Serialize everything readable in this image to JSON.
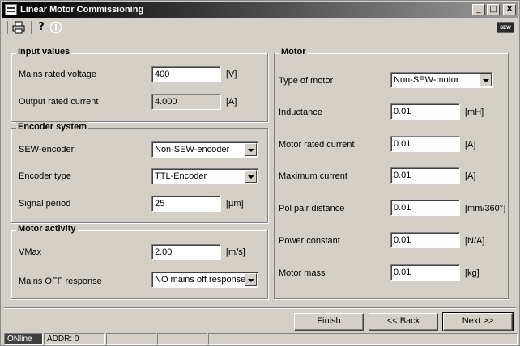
{
  "window": {
    "title": "Linear Motor Commissioning",
    "minimize": "_",
    "maximize": "□",
    "close": "X"
  },
  "toolbar": {
    "print_icon": "printer-icon",
    "help_icon": "question-icon",
    "info_icon": "info-icon",
    "logo_text": "SEW"
  },
  "input_values": {
    "title": "Input values",
    "mains_voltage_label": "Mains rated voltage",
    "mains_voltage_value": "400",
    "mains_voltage_unit": "[V]",
    "output_current_label": "Output rated current",
    "output_current_value": "4.000",
    "output_current_unit": "[A]"
  },
  "encoder_system": {
    "title": "Encoder system",
    "sew_encoder_label": "SEW-encoder",
    "sew_encoder_value": "Non-SEW-encoder",
    "encoder_type_label": "Encoder type",
    "encoder_type_value": "TTL-Encoder",
    "signal_period_label": "Signal period",
    "signal_period_value": "25",
    "signal_period_unit": "[µm]"
  },
  "motor_activity": {
    "title": "Motor activity",
    "vmax_label": "VMax",
    "vmax_value": "2.00",
    "vmax_unit": "[m/s]",
    "mains_off_label": "Mains OFF response",
    "mains_off_value": "NO mains off response"
  },
  "motor": {
    "title": "Motor",
    "type_label": "Type of motor",
    "type_value": "Non-SEW-motor",
    "inductance_label": "Inductance",
    "inductance_value": "0.01",
    "inductance_unit": "[mH]",
    "rated_current_label": "Motor rated current",
    "rated_current_value": "0.01",
    "rated_current_unit": "[A]",
    "max_current_label": "Maximum current",
    "max_current_value": "0.01",
    "max_current_unit": "[A]",
    "pol_pair_label": "Pol pair distance",
    "pol_pair_value": "0.01",
    "pol_pair_unit": "[mm/360°]",
    "power_const_label": "Power constant",
    "power_const_value": "0.01",
    "power_const_unit": "[N/A]",
    "mass_label": "Motor mass",
    "mass_value": "0.01",
    "mass_unit": "[kg]"
  },
  "buttons": {
    "finish": "Finish",
    "back": "<< Back",
    "next": "Next >>"
  },
  "status": {
    "online": "ONline",
    "addr": "ADDR: 0"
  }
}
